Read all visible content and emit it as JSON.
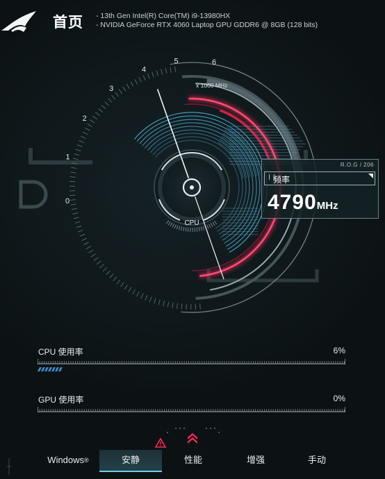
{
  "header": {
    "title": "首页",
    "cpu_spec": "-  13th Gen Intel(R) Core(TM) i9-13980HX",
    "gpu_spec": "-  NVIDIA GeForce RTX 4060 Laptop GPU GDDR6 @ 8GB (128 bits)"
  },
  "gauge": {
    "scale_label": "x 1000 MHz",
    "ticks": [
      "0",
      "1",
      "2",
      "3",
      "4",
      "5",
      "6"
    ],
    "center_label": "CPU",
    "needle_fraction": 0.8,
    "colors": {
      "accent": "#ff2a5a",
      "blue": "#4fb0d8",
      "gray": "#6f7d81"
    }
  },
  "frequency": {
    "brand": "R.O.G / 206",
    "label": "频率",
    "value": "4790",
    "unit": "MHz"
  },
  "usage": {
    "cpu": {
      "label": "CPU 使用率",
      "value": "6%",
      "fraction": 0.06
    },
    "gpu": {
      "label": "GPU 使用率",
      "value": "0%",
      "fraction": 0.0
    }
  },
  "nav": {
    "windows": "Windows",
    "windows_mark": "®",
    "quiet": "安静",
    "performance": "性能",
    "turbo": "增强",
    "manual": "手动"
  }
}
